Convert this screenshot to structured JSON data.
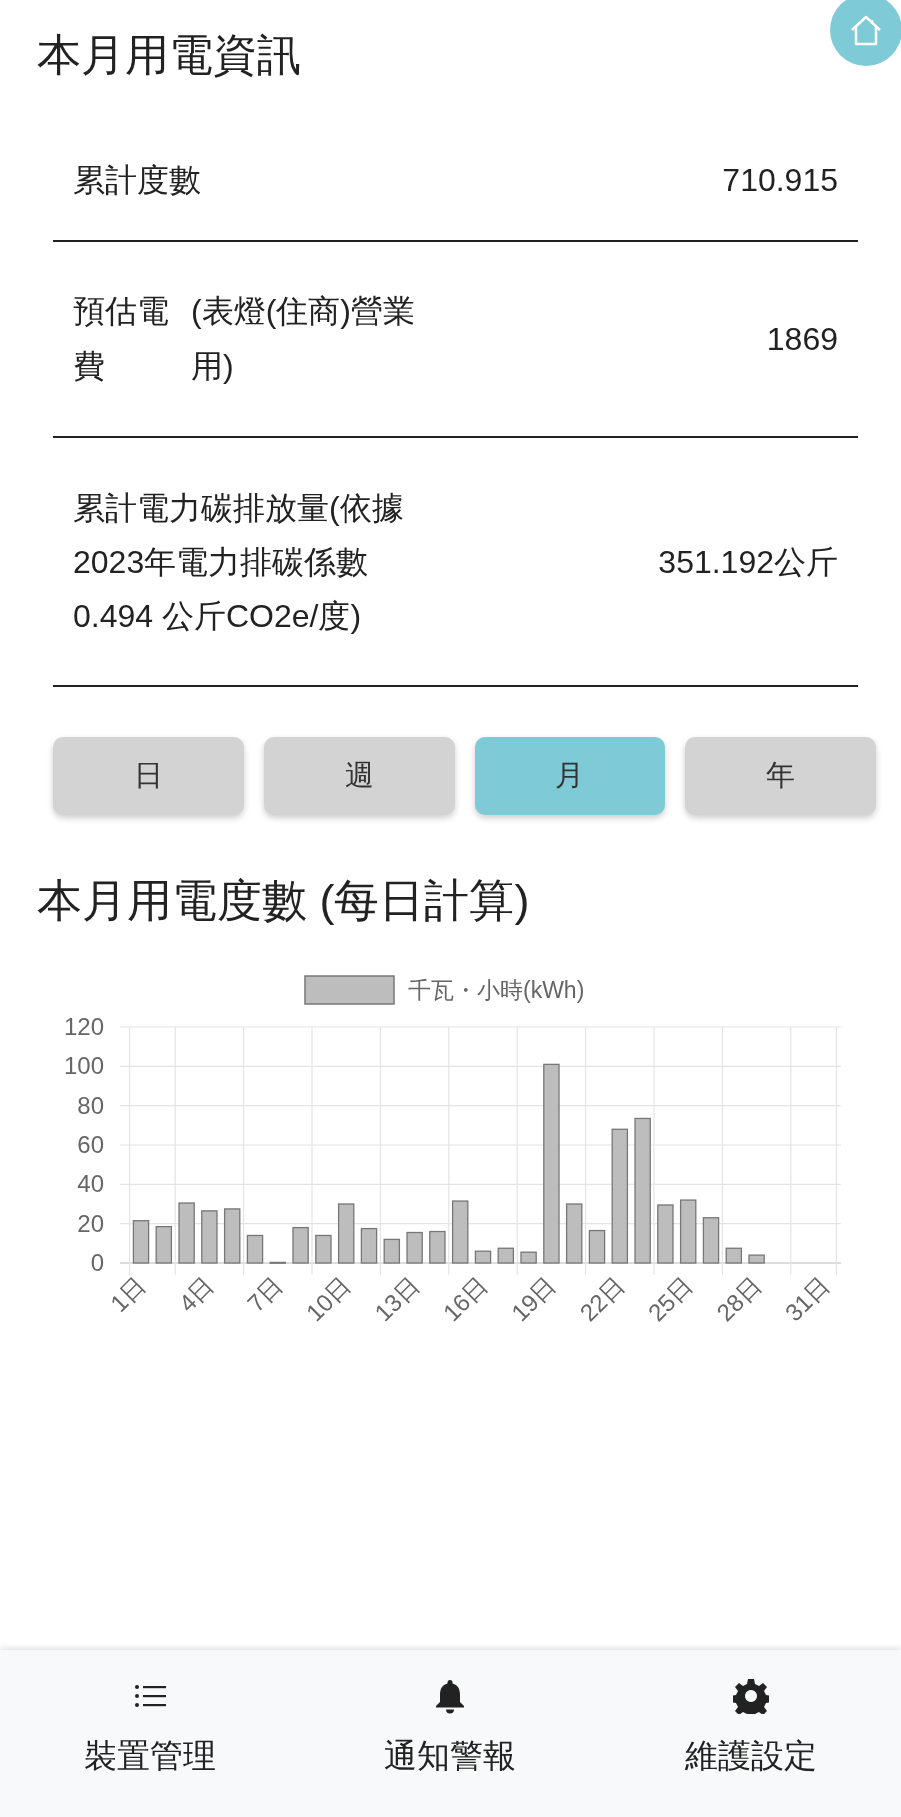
{
  "title": "本月用電資訊",
  "summary": [
    {
      "label": "累計度數",
      "value": "710.915"
    },
    {
      "label": "預估電費",
      "note": "(表燈(住商)營業用)",
      "value": "1869"
    },
    {
      "label": "累計電力碳排放量(依據2023年電力排碳係數0.494 公斤CO2e/度)",
      "value": "351.192公斤"
    }
  ],
  "periods": [
    {
      "label": "日",
      "selected": false
    },
    {
      "label": "週",
      "selected": false
    },
    {
      "label": "月",
      "selected": true
    },
    {
      "label": "年",
      "selected": false
    }
  ],
  "chart_title": "本月用電度數 (每日計算)",
  "chart_data": {
    "type": "bar",
    "x": [
      1,
      2,
      3,
      4,
      5,
      6,
      7,
      8,
      9,
      10,
      11,
      12,
      13,
      14,
      15,
      16,
      17,
      18,
      19,
      20,
      21,
      22,
      23,
      24,
      25,
      26,
      27,
      28
    ],
    "series": [
      {
        "name": "千瓦・小時(kWh)",
        "color": "#bdbdbd",
        "values": [
          21.5,
          18.5,
          30.5,
          26.5,
          27.5,
          14,
          0.3,
          18,
          14,
          30,
          17.5,
          12,
          15.5,
          16,
          31.5,
          6,
          7.5,
          5.5,
          101,
          30,
          16.5,
          68,
          73.5,
          29.5,
          32,
          23,
          7.5,
          4
        ]
      }
    ],
    "xlim": [
      0.5,
      31.5
    ],
    "grid": true,
    "ylim": [
      0,
      120
    ],
    "yticks": [
      0,
      20,
      40,
      60,
      80,
      100,
      120
    ],
    "xticks": [
      {
        "value": 1,
        "label": "1日"
      },
      {
        "value": 4,
        "label": "4日"
      },
      {
        "value": 7,
        "label": "7日"
      },
      {
        "value": 10,
        "label": "10日"
      },
      {
        "value": 13,
        "label": "13日"
      },
      {
        "value": 16,
        "label": "16日"
      },
      {
        "value": 19,
        "label": "19日"
      },
      {
        "value": 22,
        "label": "22日"
      },
      {
        "value": 25,
        "label": "25日"
      },
      {
        "value": 28,
        "label": "28日"
      },
      {
        "value": 31,
        "label": "31日"
      }
    ]
  },
  "nav": [
    {
      "kind": "list",
      "label": "裝置管理"
    },
    {
      "kind": "bell",
      "label": "通知警報"
    },
    {
      "kind": "gear",
      "label": "維護設定"
    }
  ]
}
